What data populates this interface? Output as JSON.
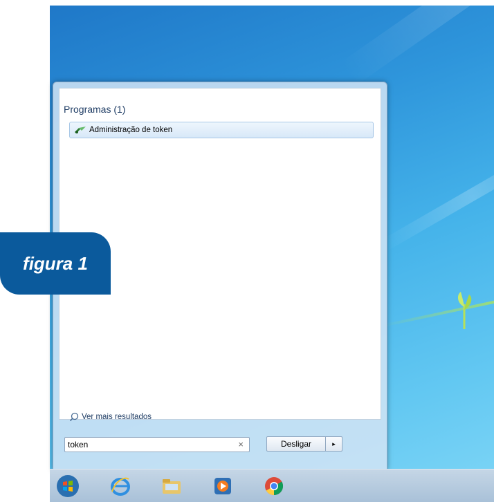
{
  "desktop": {},
  "start_menu": {
    "section_title": "Programas (1)",
    "results": [
      {
        "label": "Administração de token",
        "icon": "token-admin-icon"
      }
    ],
    "more_results_label": "Ver mais resultados",
    "search": {
      "value": "token",
      "clear_glyph": "×"
    },
    "shutdown": {
      "label": "Desligar",
      "arrow": "▸"
    }
  },
  "taskbar": {
    "items": [
      "start-orb",
      "internet-explorer-icon",
      "file-explorer-icon",
      "media-player-icon",
      "chrome-icon"
    ]
  },
  "caption": {
    "text": "figura 1"
  }
}
